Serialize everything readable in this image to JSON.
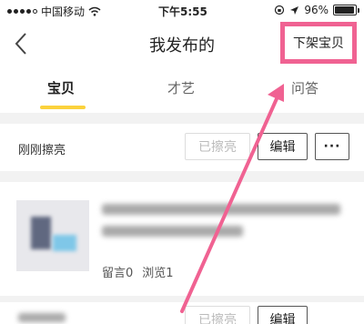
{
  "status_bar": {
    "carrier": "中国移动",
    "time": "下午5:55",
    "battery": "96%",
    "battery_level": 0.96,
    "signal_bars": 4
  },
  "nav": {
    "title": "我发布的",
    "action_label": "下架宝贝"
  },
  "tabs": [
    {
      "label": "宝贝",
      "active": true
    },
    {
      "label": "才艺",
      "active": false
    },
    {
      "label": "问答",
      "active": false
    }
  ],
  "listing_top": {
    "status_text": "刚刚擦亮",
    "polish_label": "已擦亮",
    "edit_label": "编辑",
    "more_label": "···"
  },
  "item": {
    "comments_label": "留言0",
    "views_label": "浏览1"
  },
  "listing_bottom": {
    "polish_label": "已擦亮",
    "edit_label": "编辑"
  },
  "colors": {
    "highlight": "#f06292",
    "tab_underline": "#fbd23c"
  }
}
